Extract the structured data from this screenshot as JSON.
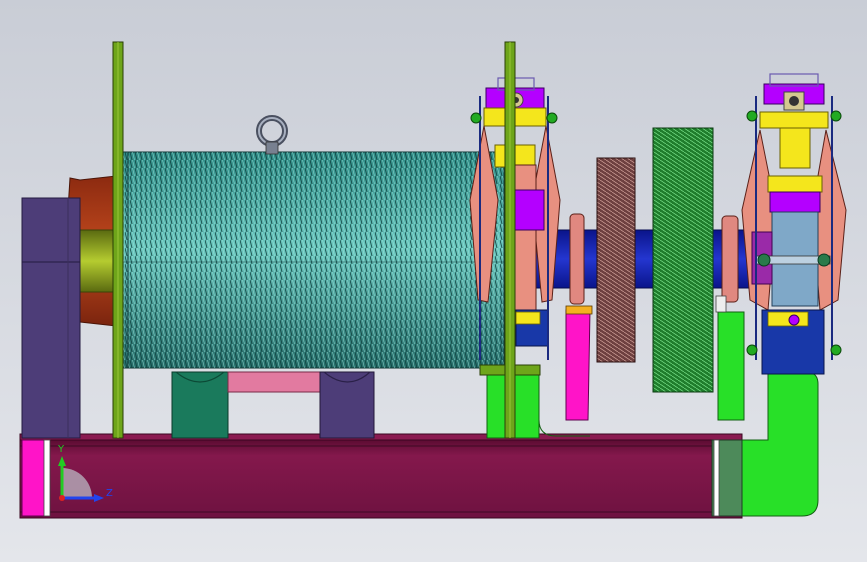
{
  "viewport": {
    "background_top": "#c9cdd6",
    "background_bottom": "#e4e6eb"
  },
  "triad": {
    "y_label": "Y",
    "z_label": "Z",
    "y_color": "#22cc22",
    "z_color": "#2244ee"
  },
  "colors": {
    "base_frame": "#7a1444",
    "drum_rope": "#3fa8a0",
    "flange": "#6ea51a",
    "shaft": "#1020b0",
    "motor_housing": "#4d3d78",
    "gear_dark": "#6e4040",
    "gear_green": "#2eaa40",
    "support_green": "#28e028",
    "pedestal": "#1a7a5c",
    "magenta": "#ff14c8",
    "pink": "#e27aa0",
    "brake_yellow": "#f4e61c",
    "brake_pink": "#e89080",
    "brake_purple": "#b400ff"
  }
}
